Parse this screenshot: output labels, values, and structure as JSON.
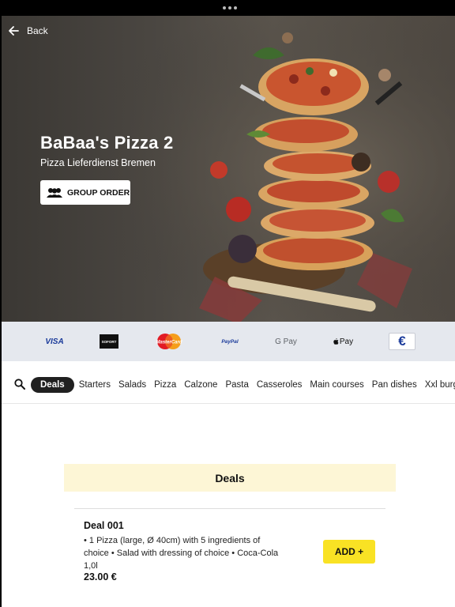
{
  "header": {
    "back_label": "Back",
    "store_name": "BaBaa's Pizza 2",
    "store_subtitle": "Pizza Lieferdienst Bremen",
    "group_order_label": "GROUP ORDER"
  },
  "payments": {
    "methods": [
      "VISA",
      "SOFORT",
      "MasterCard",
      "PayPal",
      "G Pay",
      "Pay",
      "€"
    ]
  },
  "categories": {
    "items": [
      "Deals",
      "Starters",
      "Salads",
      "Pizza",
      "Calzone",
      "Pasta",
      "Casseroles",
      "Main courses",
      "Pan dishes",
      "Xxl burgers"
    ],
    "active": "Deals"
  },
  "menu": {
    "section_title": "Deals",
    "items": [
      {
        "name": "Deal 001",
        "description": "• 1 Pizza (large, Ø 40cm) with 5 ingredients of choice • Salad with dressing of choice • Coca-Cola 1,0l",
        "price": "23.00 €",
        "add_label": "ADD +"
      }
    ]
  },
  "colors": {
    "accent_yellow": "#f9e224",
    "section_bg": "#fdf6d6",
    "active_tab": "#202020",
    "payment_bar": "#e5e8ee"
  }
}
